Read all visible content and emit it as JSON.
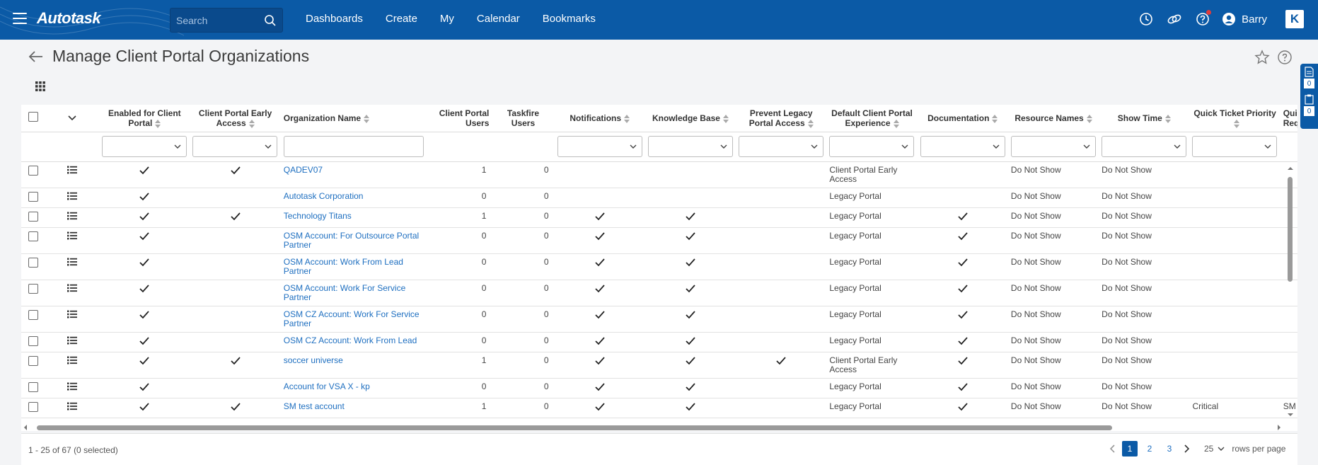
{
  "app": {
    "brand": "Autotask",
    "search_placeholder": "Search",
    "nav": [
      "Dashboards",
      "Create",
      "My",
      "Calendar",
      "Bookmarks"
    ],
    "user": "Barry",
    "brand_badge": "K",
    "accent": "#0b5aa6"
  },
  "page": {
    "title": "Manage Client Portal Organizations",
    "side_counts": [
      "0",
      "0"
    ]
  },
  "columns": [
    "Enabled for Client Portal",
    "Client Portal Early Access",
    "Organization Name",
    "Client Portal Users",
    "Taskfire Users",
    "Notifications",
    "Knowledge Base",
    "Prevent Legacy Portal Access",
    "Default Client Portal Experience",
    "Documentation",
    "Resource Names",
    "Show Time",
    "Quick Ticket Priority",
    "Quick Requ"
  ],
  "rows": [
    {
      "enabled": true,
      "early": true,
      "name": "QADEV07",
      "cp_users": "1",
      "tf_users": "0",
      "notif": false,
      "kb": false,
      "prevent": false,
      "exp": "Client Portal Early Access",
      "doc": false,
      "resnames": "Do Not Show",
      "showtime": "Do Not Show",
      "priority": "",
      "qr": ""
    },
    {
      "enabled": true,
      "early": false,
      "name": "Autotask Corporation",
      "cp_users": "0",
      "tf_users": "0",
      "notif": false,
      "kb": false,
      "prevent": false,
      "exp": "Legacy Portal",
      "doc": false,
      "resnames": "Do Not Show",
      "showtime": "Do Not Show",
      "priority": "",
      "qr": ""
    },
    {
      "enabled": true,
      "early": true,
      "name": "Technology Titans",
      "cp_users": "1",
      "tf_users": "0",
      "notif": true,
      "kb": true,
      "prevent": false,
      "exp": "Legacy Portal",
      "doc": true,
      "resnames": "Do Not Show",
      "showtime": "Do Not Show",
      "priority": "",
      "qr": ""
    },
    {
      "enabled": true,
      "early": false,
      "name": "OSM Account: For Outsource Portal Partner",
      "cp_users": "0",
      "tf_users": "0",
      "notif": true,
      "kb": true,
      "prevent": false,
      "exp": "Legacy Portal",
      "doc": true,
      "resnames": "Do Not Show",
      "showtime": "Do Not Show",
      "priority": "",
      "qr": ""
    },
    {
      "enabled": true,
      "early": false,
      "name": "OSM Account: Work From Lead Partner",
      "cp_users": "0",
      "tf_users": "0",
      "notif": true,
      "kb": true,
      "prevent": false,
      "exp": "Legacy Portal",
      "doc": true,
      "resnames": "Do Not Show",
      "showtime": "Do Not Show",
      "priority": "",
      "qr": ""
    },
    {
      "enabled": true,
      "early": false,
      "name": "OSM Account: Work For Service Partner",
      "cp_users": "0",
      "tf_users": "0",
      "notif": true,
      "kb": true,
      "prevent": false,
      "exp": "Legacy Portal",
      "doc": true,
      "resnames": "Do Not Show",
      "showtime": "Do Not Show",
      "priority": "",
      "qr": ""
    },
    {
      "enabled": true,
      "early": false,
      "name": "OSM CZ Account: Work For Service Partner",
      "cp_users": "0",
      "tf_users": "0",
      "notif": true,
      "kb": true,
      "prevent": false,
      "exp": "Legacy Portal",
      "doc": true,
      "resnames": "Do Not Show",
      "showtime": "Do Not Show",
      "priority": "",
      "qr": ""
    },
    {
      "enabled": true,
      "early": false,
      "name": "OSM CZ Account: Work From Lead",
      "cp_users": "0",
      "tf_users": "0",
      "notif": true,
      "kb": true,
      "prevent": false,
      "exp": "Legacy Portal",
      "doc": true,
      "resnames": "Do Not Show",
      "showtime": "Do Not Show",
      "priority": "",
      "qr": ""
    },
    {
      "enabled": true,
      "early": true,
      "name": "soccer universe",
      "cp_users": "1",
      "tf_users": "0",
      "notif": true,
      "kb": true,
      "prevent": true,
      "exp": "Client Portal Early Access",
      "doc": true,
      "resnames": "Do Not Show",
      "showtime": "Do Not Show",
      "priority": "",
      "qr": ""
    },
    {
      "enabled": true,
      "early": false,
      "name": "Account for VSA X - kp",
      "cp_users": "0",
      "tf_users": "0",
      "notif": true,
      "kb": true,
      "prevent": false,
      "exp": "Legacy Portal",
      "doc": true,
      "resnames": "Do Not Show",
      "showtime": "Do Not Show",
      "priority": "",
      "qr": ""
    },
    {
      "enabled": true,
      "early": true,
      "name": "SM test account",
      "cp_users": "1",
      "tf_users": "0",
      "notif": true,
      "kb": true,
      "prevent": false,
      "exp": "Legacy Portal",
      "doc": true,
      "resnames": "Do Not Show",
      "showtime": "Do Not Show",
      "priority": "Critical",
      "qr": "SM An"
    }
  ],
  "footer": {
    "range": "1 - 25 of 67",
    "selected": "(0 selected)",
    "pages": [
      "1",
      "2",
      "3"
    ],
    "active_page": "1",
    "page_size": "25",
    "rows_label": "rows per page"
  }
}
